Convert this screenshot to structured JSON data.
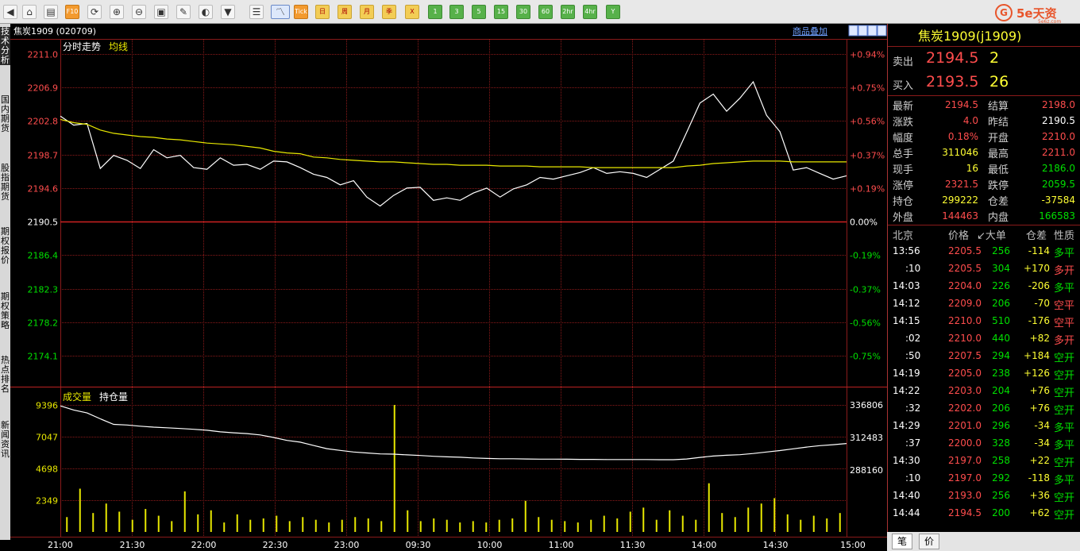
{
  "toolbar": {
    "buttons": [
      {
        "name": "back-icon",
        "label": "◀"
      },
      {
        "name": "home-icon",
        "label": "⌂"
      },
      {
        "name": "notebook-icon",
        "label": "▤"
      },
      {
        "name": "f10-icon",
        "label": "F10"
      },
      {
        "name": "refresh-icon",
        "label": "⟳"
      },
      {
        "name": "zoom-in-icon",
        "label": "⊕"
      },
      {
        "name": "zoom-out-icon",
        "label": "⊖"
      },
      {
        "name": "window-icon",
        "label": "▣"
      },
      {
        "name": "draw-icon",
        "label": "✎"
      },
      {
        "name": "broadcast-icon",
        "label": "◐"
      },
      {
        "name": "filter-icon",
        "label": "▼"
      },
      {
        "name": "report-icon",
        "label": "☰"
      },
      {
        "name": "intraday-icon",
        "label": "〽"
      },
      {
        "name": "tick-icon",
        "label": "Tick"
      },
      {
        "name": "day-button",
        "label": "日"
      },
      {
        "name": "week-button",
        "label": "周"
      },
      {
        "name": "month-button",
        "label": "月"
      },
      {
        "name": "season-button",
        "label": "季"
      },
      {
        "name": "custom-button",
        "label": "X"
      },
      {
        "name": "min1-button",
        "label": "1"
      },
      {
        "name": "min3-button",
        "label": "3"
      },
      {
        "name": "min5-button",
        "label": "5"
      },
      {
        "name": "min15-button",
        "label": "15"
      },
      {
        "name": "min30-button",
        "label": "30"
      },
      {
        "name": "min60-button",
        "label": "60"
      },
      {
        "name": "hr2-button",
        "label": "2hr"
      },
      {
        "name": "hr4-button",
        "label": "4hr"
      },
      {
        "name": "year-button",
        "label": "Y"
      }
    ]
  },
  "logo": {
    "mark": "G",
    "text": "5e天资",
    "sub": "5e6z.com"
  },
  "sidebar": {
    "tabs": [
      "技术分析",
      "国内期货",
      "股指期货",
      "期权报价",
      "期权策略",
      "热点排名",
      "新闻资讯"
    ]
  },
  "header": {
    "instrument": "焦炭1909 (020709)",
    "overlay": "商品叠加"
  },
  "main": {
    "label1": "分时走势",
    "label2": "均线"
  },
  "volume": {
    "label1": "成交量",
    "label2": "持仓量"
  },
  "chart_data": {
    "type": "line",
    "price_axis": {
      "min": 2174.1,
      "max": 2211.0,
      "ticks": [
        2211.0,
        2206.9,
        2202.8,
        2198.7,
        2194.6,
        2190.5,
        2186.4,
        2182.3,
        2178.2,
        2174.1
      ],
      "baseline": 2190.5
    },
    "pct_axis": {
      "ticks": [
        "+0.94%",
        "+0.75%",
        "+0.56%",
        "+0.37%",
        "+0.19%",
        "0.00%",
        "-0.19%",
        "-0.37%",
        "-0.56%",
        "-0.75%"
      ]
    },
    "time_labels": [
      "21:00",
      "21:30",
      "22:00",
      "22:30",
      "23:00",
      "09:30",
      "10:00",
      "11:00",
      "11:30",
      "14:00",
      "14:30",
      "15:00"
    ],
    "price_series": [
      2203.4,
      2202.3,
      2202.5,
      2197.0,
      2198.6,
      2198.0,
      2197.0,
      2199.3,
      2198.3,
      2198.6,
      2197.1,
      2196.9,
      2198.3,
      2197.4,
      2197.5,
      2196.9,
      2197.9,
      2197.8,
      2197.1,
      2196.3,
      2195.9,
      2195.0,
      2195.5,
      2193.5,
      2192.4,
      2193.7,
      2194.6,
      2194.7,
      2193.1,
      2193.4,
      2193.1,
      2194.0,
      2194.6,
      2193.5,
      2194.5,
      2195.0,
      2195.9,
      2195.7,
      2196.1,
      2196.5,
      2197.1,
      2196.4,
      2196.6,
      2196.4,
      2195.9,
      2196.9,
      2197.9,
      2201.4,
      2205.0,
      2206.1,
      2204.0,
      2205.6,
      2207.6,
      2203.5,
      2201.5,
      2196.8,
      2197.1,
      2196.4,
      2195.7,
      2196.1
    ],
    "avg_series": [
      2203.0,
      2202.6,
      2202.4,
      2201.7,
      2201.3,
      2201.1,
      2200.9,
      2200.8,
      2200.6,
      2200.5,
      2200.3,
      2200.1,
      2200.0,
      2199.9,
      2199.7,
      2199.5,
      2199.1,
      2198.9,
      2198.8,
      2198.4,
      2198.3,
      2198.1,
      2198.0,
      2197.9,
      2197.8,
      2197.8,
      2197.7,
      2197.6,
      2197.5,
      2197.5,
      2197.4,
      2197.4,
      2197.4,
      2197.3,
      2197.3,
      2197.3,
      2197.2,
      2197.2,
      2197.2,
      2197.2,
      2197.1,
      2197.1,
      2197.1,
      2197.1,
      2197.1,
      2197.1,
      2197.1,
      2197.3,
      2197.4,
      2197.6,
      2197.7,
      2197.8,
      2197.9,
      2197.9,
      2197.9,
      2197.8,
      2197.8,
      2197.8,
      2197.8,
      2197.8
    ],
    "volume_axis": {
      "max": 9396,
      "ticks": [
        9396,
        7047,
        4698,
        2349
      ]
    },
    "oi_axis": {
      "ticks": [
        336806,
        312483,
        288160
      ]
    },
    "volume_series": [
      1100,
      3200,
      1400,
      2100,
      1500,
      900,
      1700,
      1200,
      800,
      3000,
      1300,
      1600,
      700,
      1300,
      900,
      1000,
      1200,
      800,
      1100,
      900,
      700,
      900,
      1100,
      1000,
      800,
      9396,
      1600,
      800,
      1000,
      900,
      700,
      800,
      700,
      900,
      1000,
      2300,
      1100,
      900,
      800,
      700,
      900,
      1200,
      1000,
      1500,
      1800,
      900,
      1600,
      1200,
      900,
      3600,
      1400,
      1100,
      1800,
      2100,
      2500,
      1300,
      900,
      1200,
      1000,
      1400
    ],
    "oi_series": [
      336100,
      333000,
      330800,
      326400,
      322300,
      321800,
      320900,
      320200,
      319700,
      319200,
      318600,
      317900,
      316700,
      316000,
      315400,
      314400,
      312500,
      310300,
      309000,
      306500,
      304100,
      302800,
      301600,
      300900,
      300200,
      300000,
      299500,
      299000,
      298400,
      298000,
      297700,
      297200,
      296800,
      296600,
      296600,
      296400,
      296300,
      296300,
      296200,
      296100,
      296100,
      296000,
      296000,
      296000,
      296000,
      295900,
      295900,
      296400,
      297600,
      298600,
      299200,
      299600,
      300500,
      301600,
      302700,
      304000,
      305300,
      306400,
      307100,
      308000
    ]
  },
  "panel": {
    "title": "焦炭1909(j1909)",
    "sell": {
      "label": "卖出",
      "price": "2194.5",
      "vol": "2"
    },
    "buy": {
      "label": "买入",
      "price": "2193.5",
      "vol": "26"
    },
    "stats": [
      {
        "l1": "最新",
        "v1": "2194.5",
        "c1": "red",
        "l2": "结算",
        "v2": "2198.0",
        "c2": "red"
      },
      {
        "l1": "涨跌",
        "v1": "4.0",
        "c1": "red",
        "l2": "昨结",
        "v2": "2190.5",
        "c2": "white"
      },
      {
        "l1": "幅度",
        "v1": "0.18%",
        "c1": "red",
        "l2": "开盘",
        "v2": "2210.0",
        "c2": "red"
      },
      {
        "l1": "总手",
        "v1": "311046",
        "c1": "yellow",
        "l2": "最高",
        "v2": "2211.0",
        "c2": "red"
      },
      {
        "l1": "现手",
        "v1": "16",
        "c1": "yellow",
        "l2": "最低",
        "v2": "2186.0",
        "c2": "green"
      },
      {
        "l1": "涨停",
        "v1": "2321.5",
        "c1": "red",
        "l2": "跌停",
        "v2": "2059.5",
        "c2": "green"
      },
      {
        "l1": "持仓",
        "v1": "299222",
        "c1": "yellow",
        "l2": "仓差",
        "v2": "-37584",
        "c2": "yellow"
      },
      {
        "l1": "外盘",
        "v1": "144463",
        "c1": "red",
        "l2": "内盘",
        "v2": "166583",
        "c2": "green"
      }
    ],
    "ticks_header": {
      "time": "北京",
      "price": "价格",
      "vol": "↙大单",
      "oi": "仓差",
      "nature": "性质"
    },
    "ticks": [
      {
        "time": "13:56",
        "price": "2205.5",
        "vol": "256",
        "oi": "-114",
        "oic": "yellow",
        "nature": "多平",
        "nc": "green"
      },
      {
        "time": ":10",
        "price": "2205.5",
        "vol": "304",
        "oi": "+170",
        "oic": "yellow",
        "nature": "多开",
        "nc": "red"
      },
      {
        "time": "14:03",
        "price": "2204.0",
        "vol": "226",
        "oi": "-206",
        "oic": "yellow",
        "nature": "多平",
        "nc": "green"
      },
      {
        "time": "14:12",
        "price": "2209.0",
        "vol": "206",
        "oi": "-70",
        "oic": "yellow",
        "nature": "空平",
        "nc": "red"
      },
      {
        "time": "14:15",
        "price": "2210.0",
        "vol": "510",
        "oi": "-176",
        "oic": "yellow",
        "nature": "空平",
        "nc": "red"
      },
      {
        "time": ":02",
        "price": "2210.0",
        "vol": "440",
        "oi": "+82",
        "oic": "yellow",
        "nature": "多开",
        "nc": "red"
      },
      {
        "time": ":50",
        "price": "2207.5",
        "vol": "294",
        "oi": "+184",
        "oic": "yellow",
        "nature": "空开",
        "nc": "green"
      },
      {
        "time": "14:19",
        "price": "2205.0",
        "vol": "238",
        "oi": "+126",
        "oic": "yellow",
        "nature": "空开",
        "nc": "green"
      },
      {
        "time": "14:22",
        "price": "2203.0",
        "vol": "204",
        "oi": "+76",
        "oic": "yellow",
        "nature": "空开",
        "nc": "green"
      },
      {
        "time": ":32",
        "price": "2202.0",
        "vol": "206",
        "oi": "+76",
        "oic": "yellow",
        "nature": "空开",
        "nc": "green"
      },
      {
        "time": "14:29",
        "price": "2201.0",
        "vol": "296",
        "oi": "-34",
        "oic": "yellow",
        "nature": "多平",
        "nc": "green"
      },
      {
        "time": ":37",
        "price": "2200.0",
        "vol": "328",
        "oi": "-34",
        "oic": "yellow",
        "nature": "多平",
        "nc": "green"
      },
      {
        "time": "14:30",
        "price": "2197.0",
        "vol": "258",
        "oi": "+22",
        "oic": "yellow",
        "nature": "空开",
        "nc": "green"
      },
      {
        "time": ":10",
        "price": "2197.0",
        "vol": "292",
        "oi": "-118",
        "oic": "yellow",
        "nature": "多平",
        "nc": "green"
      },
      {
        "time": "14:40",
        "price": "2193.0",
        "vol": "256",
        "oi": "+36",
        "oic": "yellow",
        "nature": "空开",
        "nc": "green"
      },
      {
        "time": "14:44",
        "price": "2194.5",
        "vol": "200",
        "oi": "+62",
        "oic": "yellow",
        "nature": "空开",
        "nc": "green"
      }
    ],
    "tabs": [
      "笔",
      "价"
    ]
  },
  "colors": {
    "price": "#ffffff",
    "avg": "#e8e800",
    "grid": "#8a1a1a",
    "up": "#ff4d4d",
    "down": "#00e000",
    "volume": "#e8e800"
  }
}
